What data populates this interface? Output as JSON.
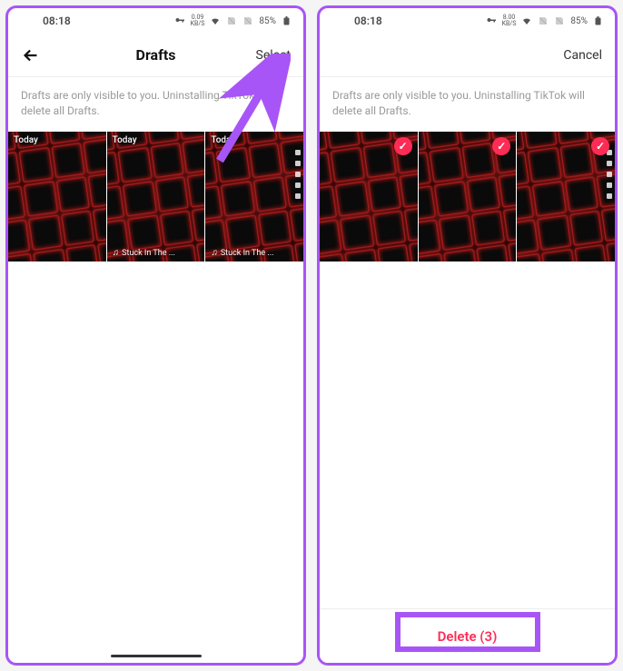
{
  "left": {
    "statusbar": {
      "time": "08:18",
      "speed_val": "0.09",
      "speed_unit": "KB/S",
      "battery": "85%"
    },
    "header": {
      "title": "Drafts",
      "action": "Select"
    },
    "info": "Drafts are only visible to you. Uninstalling TikTok will delete all Drafts.",
    "drafts": [
      {
        "top_label": "Today"
      },
      {
        "top_label": "Today",
        "bottom_label": "Stuck In The ..."
      },
      {
        "top_label": "Today",
        "bottom_label": "Stuck In The ..."
      }
    ]
  },
  "right": {
    "statusbar": {
      "time": "08:18",
      "speed_val": "8.00",
      "speed_unit": "KB/S",
      "battery": "85%"
    },
    "header": {
      "action": "Cancel"
    },
    "info": "Drafts are only visible to you. Uninstalling TikTok will delete all Drafts.",
    "drafts": [
      {
        "selected": true
      },
      {
        "selected": true
      },
      {
        "selected": true
      }
    ],
    "delete_label": "Delete (3)"
  }
}
